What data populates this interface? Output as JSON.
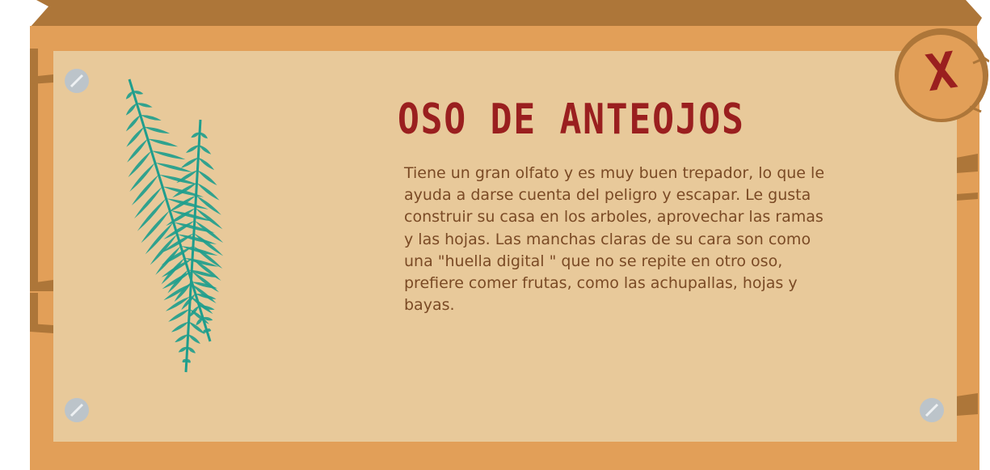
{
  "colors": {
    "plank_light": "#e29f58",
    "plank_dark": "#ad7639",
    "panel": "#e8c99a",
    "title": "#9a1f1f",
    "text": "#7a4a25",
    "fern": "#1f9e8d",
    "screw": "#bcc4ca"
  },
  "sign": {
    "title": "OSO DE ANTEOJOS",
    "description": "Tiene un gran olfato y es muy buen trepador, lo que le ayuda a darse cuenta del peligro y escapar. Le gusta construir su casa en los arboles, aprovechar las ramas y las hojas. Las manchas claras de su cara son como una \"huella digital \" que no se repite en otro oso, prefiere comer frutas, como las achupallas, hojas y bayas.",
    "close_label": "X"
  },
  "icons": {
    "close": "close-icon",
    "fern": "fern-leaf-icon",
    "screw": "screw-icon"
  }
}
